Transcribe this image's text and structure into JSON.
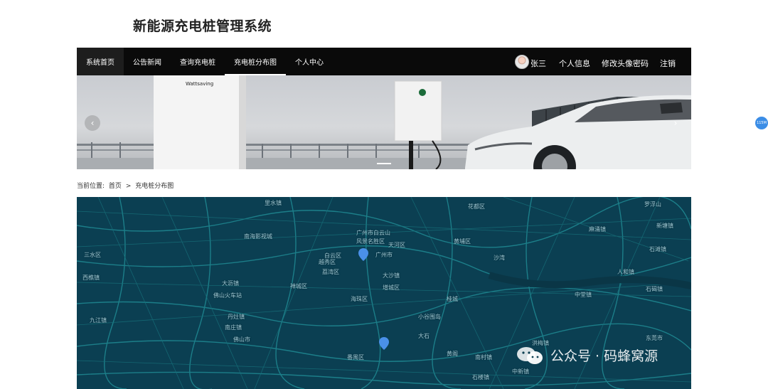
{
  "site": {
    "title": "新能源充电桩管理系统"
  },
  "nav": {
    "items": [
      {
        "label": "系统首页"
      },
      {
        "label": "公告新闻"
      },
      {
        "label": "查询充电桩"
      },
      {
        "label": "充电桩分布图"
      },
      {
        "label": "个人中心"
      }
    ],
    "active_index": 3,
    "user": {
      "name": "张三"
    },
    "links": [
      {
        "label": "个人信息"
      },
      {
        "label": "修改头像密码"
      },
      {
        "label": "注销"
      }
    ]
  },
  "banner": {
    "charger_brand": "Wattsaving",
    "prev_glyph": "‹",
    "next_glyph": "›",
    "slide_count": 1
  },
  "breadcrumb": {
    "prefix": "当前位置:",
    "home": "首页",
    "separator": ">",
    "current": "充电桩分布图"
  },
  "map": {
    "labels": [
      "南海影视城",
      "广州市白云山",
      "风景名胜区",
      "白云区",
      "广州市",
      "黄埔区",
      "荔湾区",
      "大沙镇",
      "大沥镇",
      "佛山火车站",
      "丹灶镇",
      "三水区",
      "西樵镇",
      "海珠区",
      "小谷围岛",
      "番禺区",
      "中堂镇",
      "麻涌镇",
      "石碣镇",
      "东莞市",
      "里水镇",
      "新塘镇",
      "石滩镇",
      "南庄镇",
      "九江镇",
      "石楼镇",
      "南村镇",
      "洪梅镇",
      "禅城区",
      "佛山市",
      "越秀区",
      "天河区",
      "大石",
      "黄阁",
      "沙湾",
      "增城区",
      "桂城",
      "人和镇",
      "花都区",
      "罗浮山",
      "中新镇"
    ],
    "colors": {
      "background": "#0b3f52",
      "roads": "#1f8a93",
      "markers": "#4a90e8"
    }
  },
  "side_badge": {
    "text": "115M"
  },
  "watermark": {
    "text": "公众号 · 码蜂窝源"
  }
}
